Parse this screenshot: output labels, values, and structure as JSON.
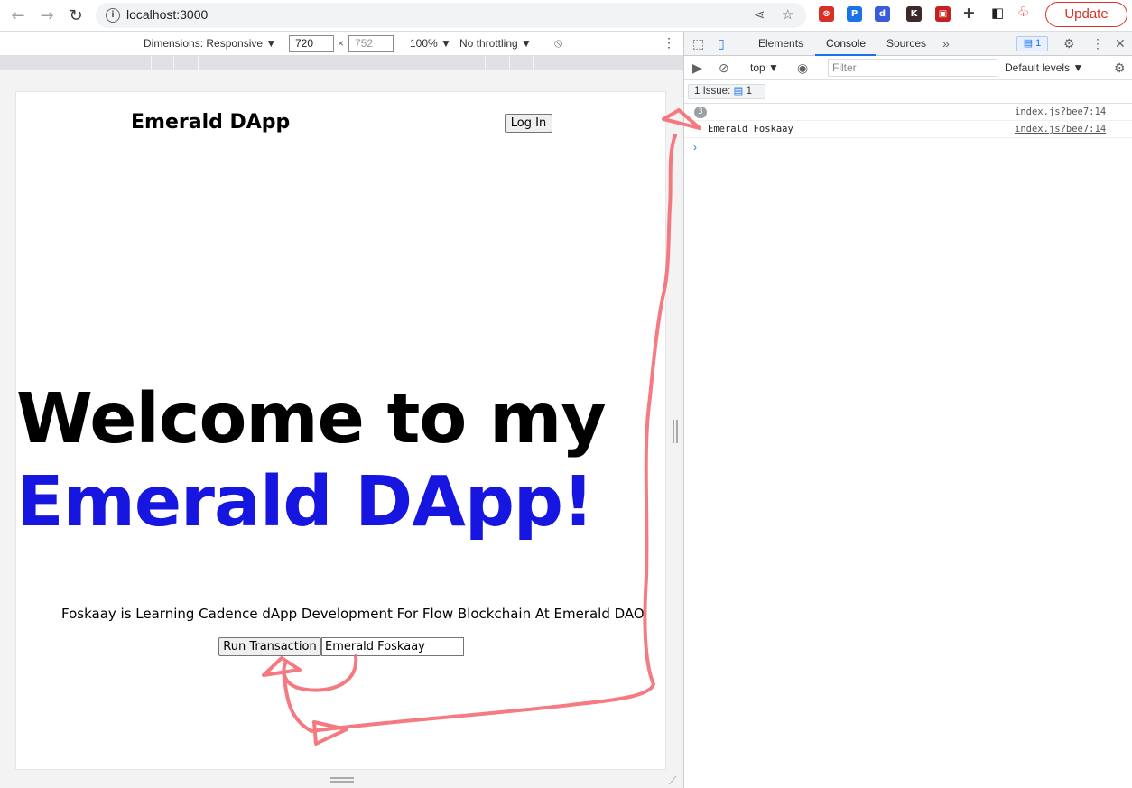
{
  "browser": {
    "url": "localhost:3000",
    "update_label": "Update",
    "extensions": [
      {
        "name": "extension-icon-1",
        "color": "#d93025",
        "glyph": "⊗"
      },
      {
        "name": "extension-icon-2",
        "color": "#1a73e8",
        "glyph": "P"
      },
      {
        "name": "extension-icon-3",
        "color": "#3c5bd6",
        "glyph": "d"
      },
      {
        "name": "extension-icon-4",
        "color": "#3c2a2a",
        "glyph": "K"
      },
      {
        "name": "extension-icon-5",
        "color": "#c5221f",
        "glyph": "▣"
      }
    ]
  },
  "device_toolbar": {
    "dimensions_label": "Dimensions: Responsive ▼",
    "width": "720",
    "height": "752",
    "x_sep": "×",
    "zoom": "100% ▼",
    "throttling": "No throttling ▼"
  },
  "page": {
    "site_title": "Emerald DApp",
    "login_label": "Log In",
    "hero_line1": "Welcome to my",
    "hero_line2": "Emerald DApp!",
    "subtitle": "Foskaay is Learning Cadence dApp Development For Flow Blockchain At Emerald DAO",
    "run_label": "Run Transaction",
    "input_value": "Emerald Foskaay",
    "hero_accent_color": "#1616e0"
  },
  "devtools": {
    "tabs": {
      "elements": "Elements",
      "console": "Console",
      "sources": "Sources"
    },
    "issues_count": "1",
    "context": "top ▼",
    "filter_placeholder": "Filter",
    "levels": "Default levels ▼",
    "issues_bar": "1 Issue:",
    "issues_bar_count": "1",
    "logs": [
      {
        "count": "3",
        "message": "",
        "source": "index.js?bee7:14"
      },
      {
        "count": "",
        "message": "Emerald Foskaay",
        "source": "index.js?bee7:14"
      }
    ],
    "prompt": "›"
  },
  "annotation_color": "#f56b73"
}
